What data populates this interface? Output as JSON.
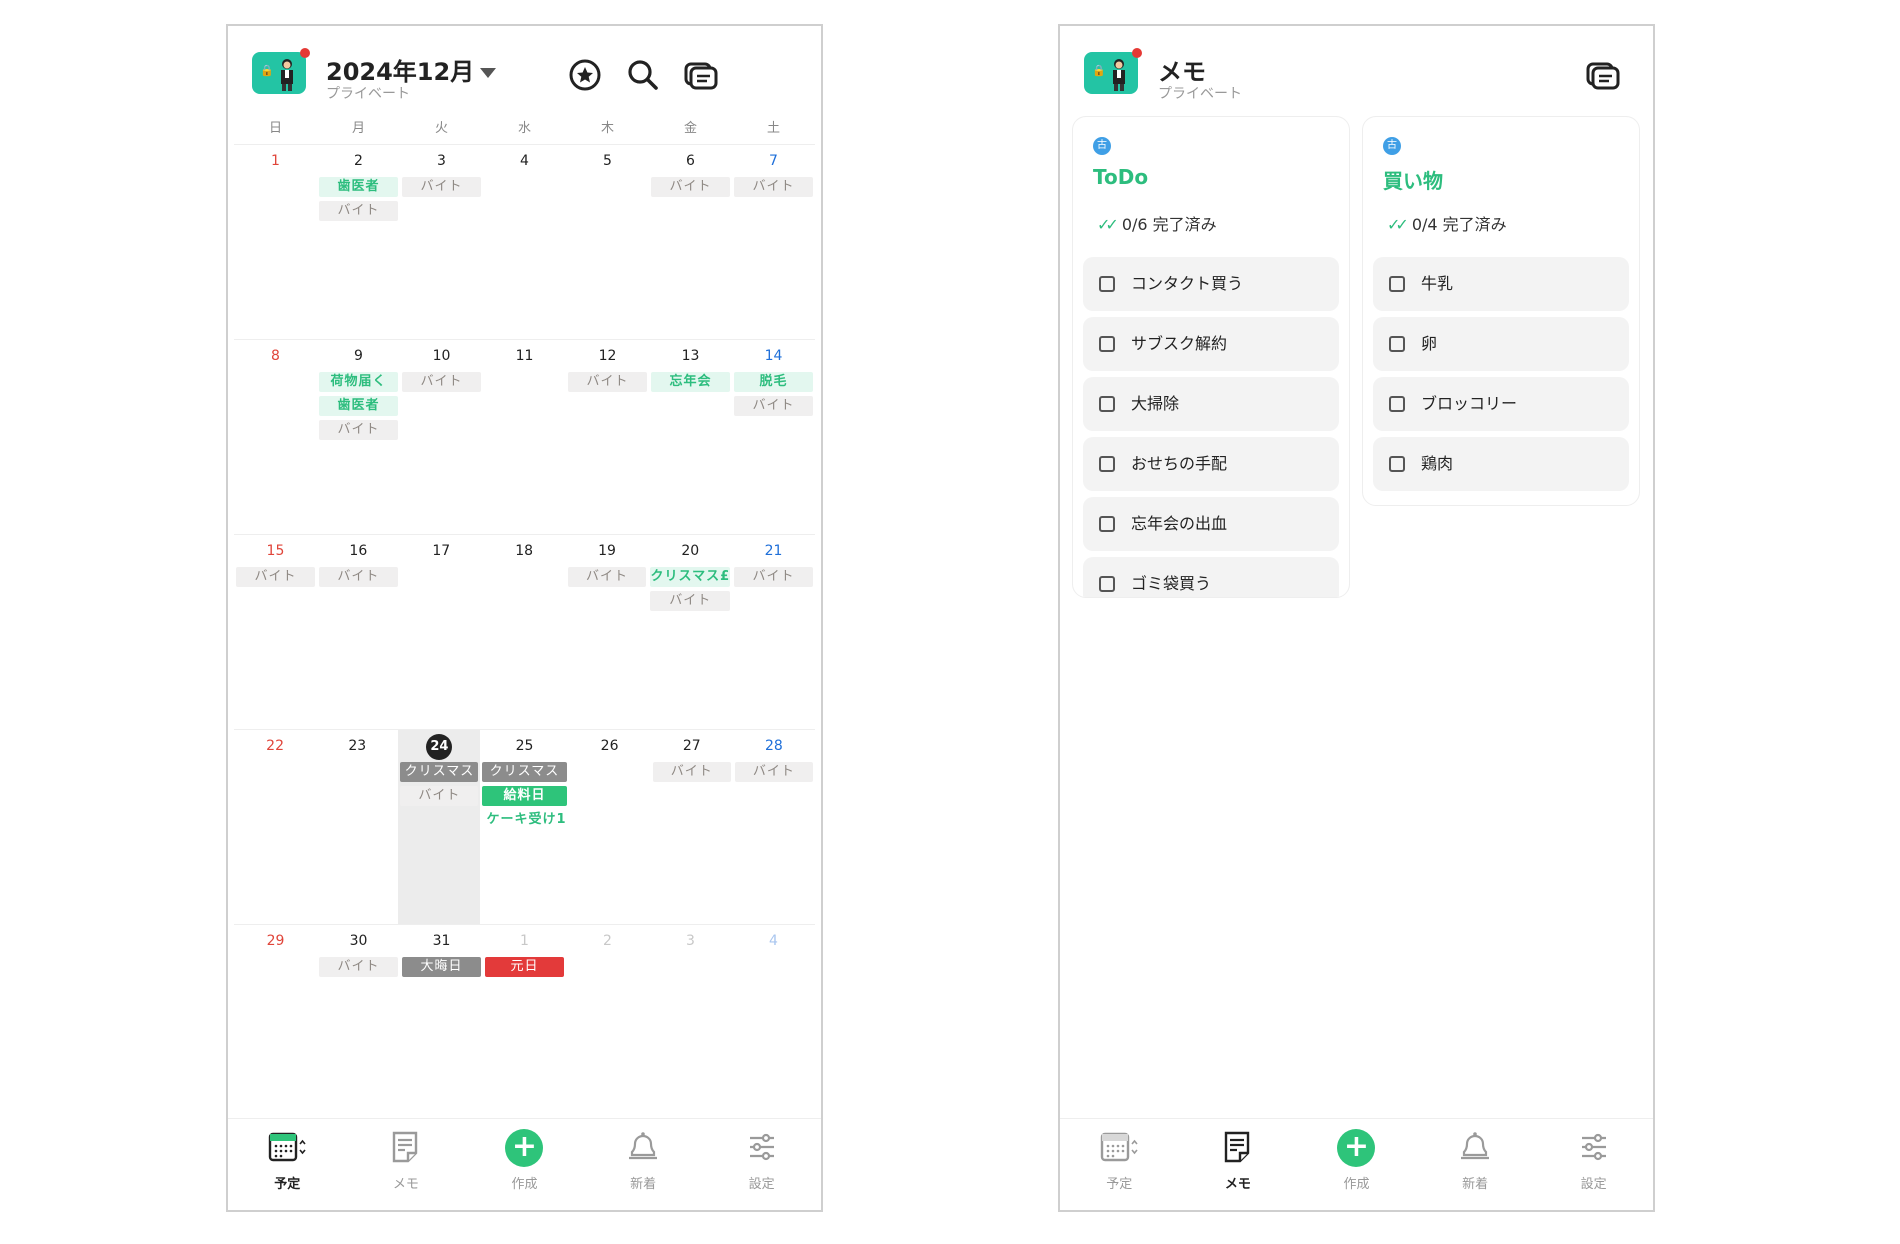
{
  "calendar_screen": {
    "header": {
      "title": "2024年12月",
      "subtitle": "プライベート"
    },
    "weekdays": [
      "日",
      "月",
      "火",
      "水",
      "木",
      "金",
      "土"
    ],
    "weeks": [
      [
        {
          "day": "1",
          "events": []
        },
        {
          "day": "2",
          "events": [
            {
              "t": "歯医者",
              "s": "green"
            },
            {
              "t": "バイト",
              "s": "gray"
            }
          ]
        },
        {
          "day": "3",
          "events": [
            {
              "t": "バイト",
              "s": "gray"
            }
          ]
        },
        {
          "day": "4",
          "events": []
        },
        {
          "day": "5",
          "events": []
        },
        {
          "day": "6",
          "events": [
            {
              "t": "バイト",
              "s": "gray"
            }
          ]
        },
        {
          "day": "7",
          "events": [
            {
              "t": "バイト",
              "s": "gray"
            }
          ]
        }
      ],
      [
        {
          "day": "8",
          "events": []
        },
        {
          "day": "9",
          "events": [
            {
              "t": "荷物届く",
              "s": "green"
            },
            {
              "t": "歯医者",
              "s": "green"
            },
            {
              "t": "バイト",
              "s": "gray"
            }
          ]
        },
        {
          "day": "10",
          "events": [
            {
              "t": "バイト",
              "s": "gray"
            }
          ]
        },
        {
          "day": "11",
          "events": []
        },
        {
          "day": "12",
          "events": [
            {
              "t": "バイト",
              "s": "gray"
            }
          ]
        },
        {
          "day": "13",
          "events": [
            {
              "t": "忘年会",
              "s": "green"
            }
          ]
        },
        {
          "day": "14",
          "events": [
            {
              "t": "脱毛",
              "s": "green"
            },
            {
              "t": "バイト",
              "s": "gray"
            }
          ]
        }
      ],
      [
        {
          "day": "15",
          "events": [
            {
              "t": "バイト",
              "s": "gray"
            }
          ]
        },
        {
          "day": "16",
          "events": [
            {
              "t": "バイト",
              "s": "gray"
            }
          ]
        },
        {
          "day": "17",
          "events": []
        },
        {
          "day": "18",
          "events": []
        },
        {
          "day": "19",
          "events": [
            {
              "t": "バイト",
              "s": "gray"
            }
          ]
        },
        {
          "day": "20",
          "events": [
            {
              "t": "クリスマス£",
              "s": "green"
            },
            {
              "t": "バイト",
              "s": "gray"
            }
          ]
        },
        {
          "day": "21",
          "events": [
            {
              "t": "バイト",
              "s": "gray"
            }
          ]
        }
      ],
      [
        {
          "day": "22",
          "events": []
        },
        {
          "day": "23",
          "events": []
        },
        {
          "day": "24",
          "today": true,
          "events": [
            {
              "t": "クリスマス",
              "s": "dgray"
            },
            {
              "t": "バイト",
              "s": "gray"
            }
          ]
        },
        {
          "day": "25",
          "events": [
            {
              "t": "クリスマス",
              "s": "dgray"
            },
            {
              "t": "給料日",
              "s": "solid-green"
            },
            {
              "t": "ケーキ受け1",
              "s": "text-green"
            }
          ]
        },
        {
          "day": "26",
          "events": []
        },
        {
          "day": "27",
          "events": [
            {
              "t": "バイト",
              "s": "gray"
            }
          ]
        },
        {
          "day": "28",
          "events": [
            {
              "t": "バイト",
              "s": "gray"
            }
          ]
        }
      ],
      [
        {
          "day": "29",
          "events": []
        },
        {
          "day": "30",
          "events": [
            {
              "t": "バイト",
              "s": "gray"
            }
          ]
        },
        {
          "day": "31",
          "events": [
            {
              "t": "大晦日",
              "s": "dgray"
            }
          ]
        },
        {
          "day": "1",
          "dim": true,
          "events": [
            {
              "t": "元日",
              "s": "red"
            }
          ]
        },
        {
          "day": "2",
          "dim": true,
          "events": []
        },
        {
          "day": "3",
          "dim": true,
          "events": []
        },
        {
          "day": "4",
          "dim": true,
          "events": []
        }
      ]
    ]
  },
  "memo_screen": {
    "header": {
      "title": "メモ",
      "subtitle": "プライベート"
    },
    "cards": [
      {
        "pin": "古",
        "title": "ToDo",
        "progress": "0/6 完了済み",
        "items": [
          "コンタクト買う",
          "サブスク解約",
          "大掃除",
          "おせちの手配",
          "忘年会の出血",
          "ゴミ袋買う"
        ]
      },
      {
        "pin": "古",
        "title": "買い物",
        "progress": "0/4 完了済み",
        "items": [
          "牛乳",
          "卵",
          "ブロッコリー",
          "鶏肉"
        ]
      }
    ]
  },
  "nav": {
    "items": [
      {
        "label": "予定",
        "icon": "calendar-icon"
      },
      {
        "label": "メモ",
        "icon": "memo-icon"
      },
      {
        "label": "作成",
        "icon": "plus-icon"
      },
      {
        "label": "新着",
        "icon": "bell-icon"
      },
      {
        "label": "設定",
        "icon": "settings-sliders-icon"
      }
    ]
  },
  "colors": {
    "accent": "#2ec47a",
    "avatar_bg": "#23c4a4",
    "sunday": "#e0453a",
    "saturday": "#1e6fd9",
    "notification": "#e53935"
  }
}
